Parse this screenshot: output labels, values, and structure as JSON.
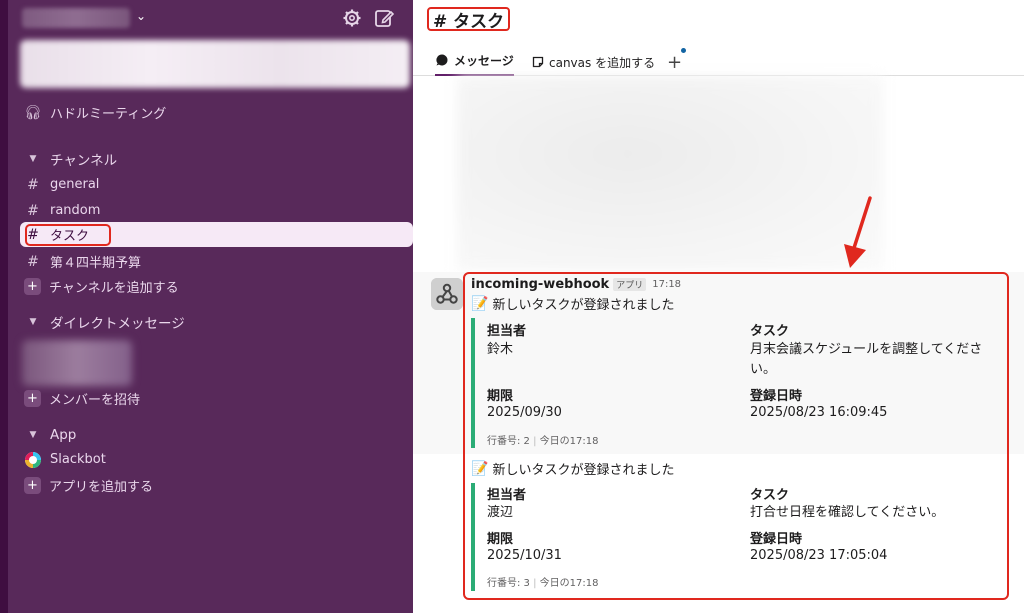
{
  "sidebar": {
    "huddle_label": "ハドルミーティング",
    "channels_section": "チャンネル",
    "channels": [
      {
        "name": "general"
      },
      {
        "name": "random"
      },
      {
        "name": "タスク"
      },
      {
        "name": "第４四半期予算"
      }
    ],
    "add_channel": "チャンネルを追加する",
    "dm_section": "ダイレクトメッセージ",
    "invite_members": "メンバーを招待",
    "app_section": "App",
    "slackbot": "Slackbot",
    "add_app": "アプリを追加する"
  },
  "header": {
    "channel_title": "# タスク",
    "tab_messages": "メッセージ",
    "tab_canvas": "canvas を追加する",
    "tab_add": "+"
  },
  "message": {
    "sender": "incoming-webhook",
    "app_badge": "アプリ",
    "time": "17:18",
    "posts": [
      {
        "title": "新しいタスクが登録されました",
        "assignee_label": "担当者",
        "assignee": "鈴木",
        "task_label": "タスク",
        "task": "月末会議スケジュールを調整してくださ\nい。",
        "task_line1": "月末会議スケジュールを調整してくださ",
        "task_line2": "い。",
        "due_label": "期限",
        "due": "2025/09/30",
        "registered_label": "登録日時",
        "registered": "2025/08/23 16:09:45",
        "footer_row": "行番号: 2",
        "footer_time": "今日の17:18"
      },
      {
        "title": "新しいタスクが登録されました",
        "assignee_label": "担当者",
        "assignee": "渡辺",
        "task_label": "タスク",
        "task": "打合せ日程を確認してください。",
        "due_label": "期限",
        "due": "2025/10/31",
        "registered_label": "登録日時",
        "registered": "2025/08/23 17:05:04",
        "footer_row": "行番号: 3",
        "footer_time": "今日の17:18"
      }
    ]
  },
  "colors": {
    "sidebar_bg": "#58295a",
    "accent": "#611f69",
    "attachment_bar": "#2bac76",
    "highlight_red": "#e0281e"
  }
}
